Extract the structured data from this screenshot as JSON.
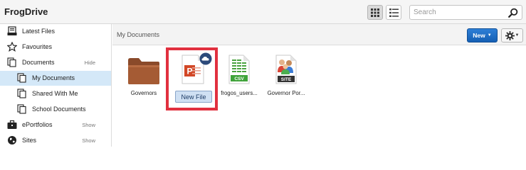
{
  "header": {
    "title": "FrogDrive",
    "search": {
      "placeholder": "Search",
      "value": ""
    }
  },
  "sidebar": {
    "items": [
      {
        "label": "Latest Files",
        "icon": "latest-files-icon",
        "active": false
      },
      {
        "label": "Favourites",
        "icon": "star-icon",
        "active": false
      },
      {
        "label": "Documents",
        "icon": "documents-icon",
        "action": "Hide",
        "active": false
      },
      {
        "label": "My Documents",
        "icon": "document-icon",
        "active": true
      },
      {
        "label": "Shared With Me",
        "icon": "document-icon",
        "active": false
      },
      {
        "label": "School Documents",
        "icon": "document-icon",
        "active": false
      },
      {
        "label": "ePortfolios",
        "icon": "briefcase-icon",
        "action": "Show",
        "active": false
      },
      {
        "label": "Sites",
        "icon": "globe-icon",
        "action": "Show",
        "active": false
      }
    ]
  },
  "main": {
    "location": "My Documents",
    "new_label": "New",
    "files": [
      {
        "label": "Governors",
        "type": "folder",
        "icon": "folder-icon"
      },
      {
        "label": "",
        "type": "powerpoint",
        "icon": "powerpoint-icon",
        "badge": "cloud-upload-icon",
        "rename_value": "New File"
      },
      {
        "label": "frogos_users...",
        "type": "csv",
        "icon": "csv-file-icon",
        "badge_text": "CSV"
      },
      {
        "label": "Governor Por...",
        "type": "site",
        "icon": "site-file-icon",
        "badge_text": "SITE"
      }
    ]
  },
  "colors": {
    "accent": "#1a6fce",
    "highlight": "#e1303f",
    "active_row": "#d4e8f8",
    "powerpoint": "#d24726",
    "csv": "#3fa33a"
  }
}
